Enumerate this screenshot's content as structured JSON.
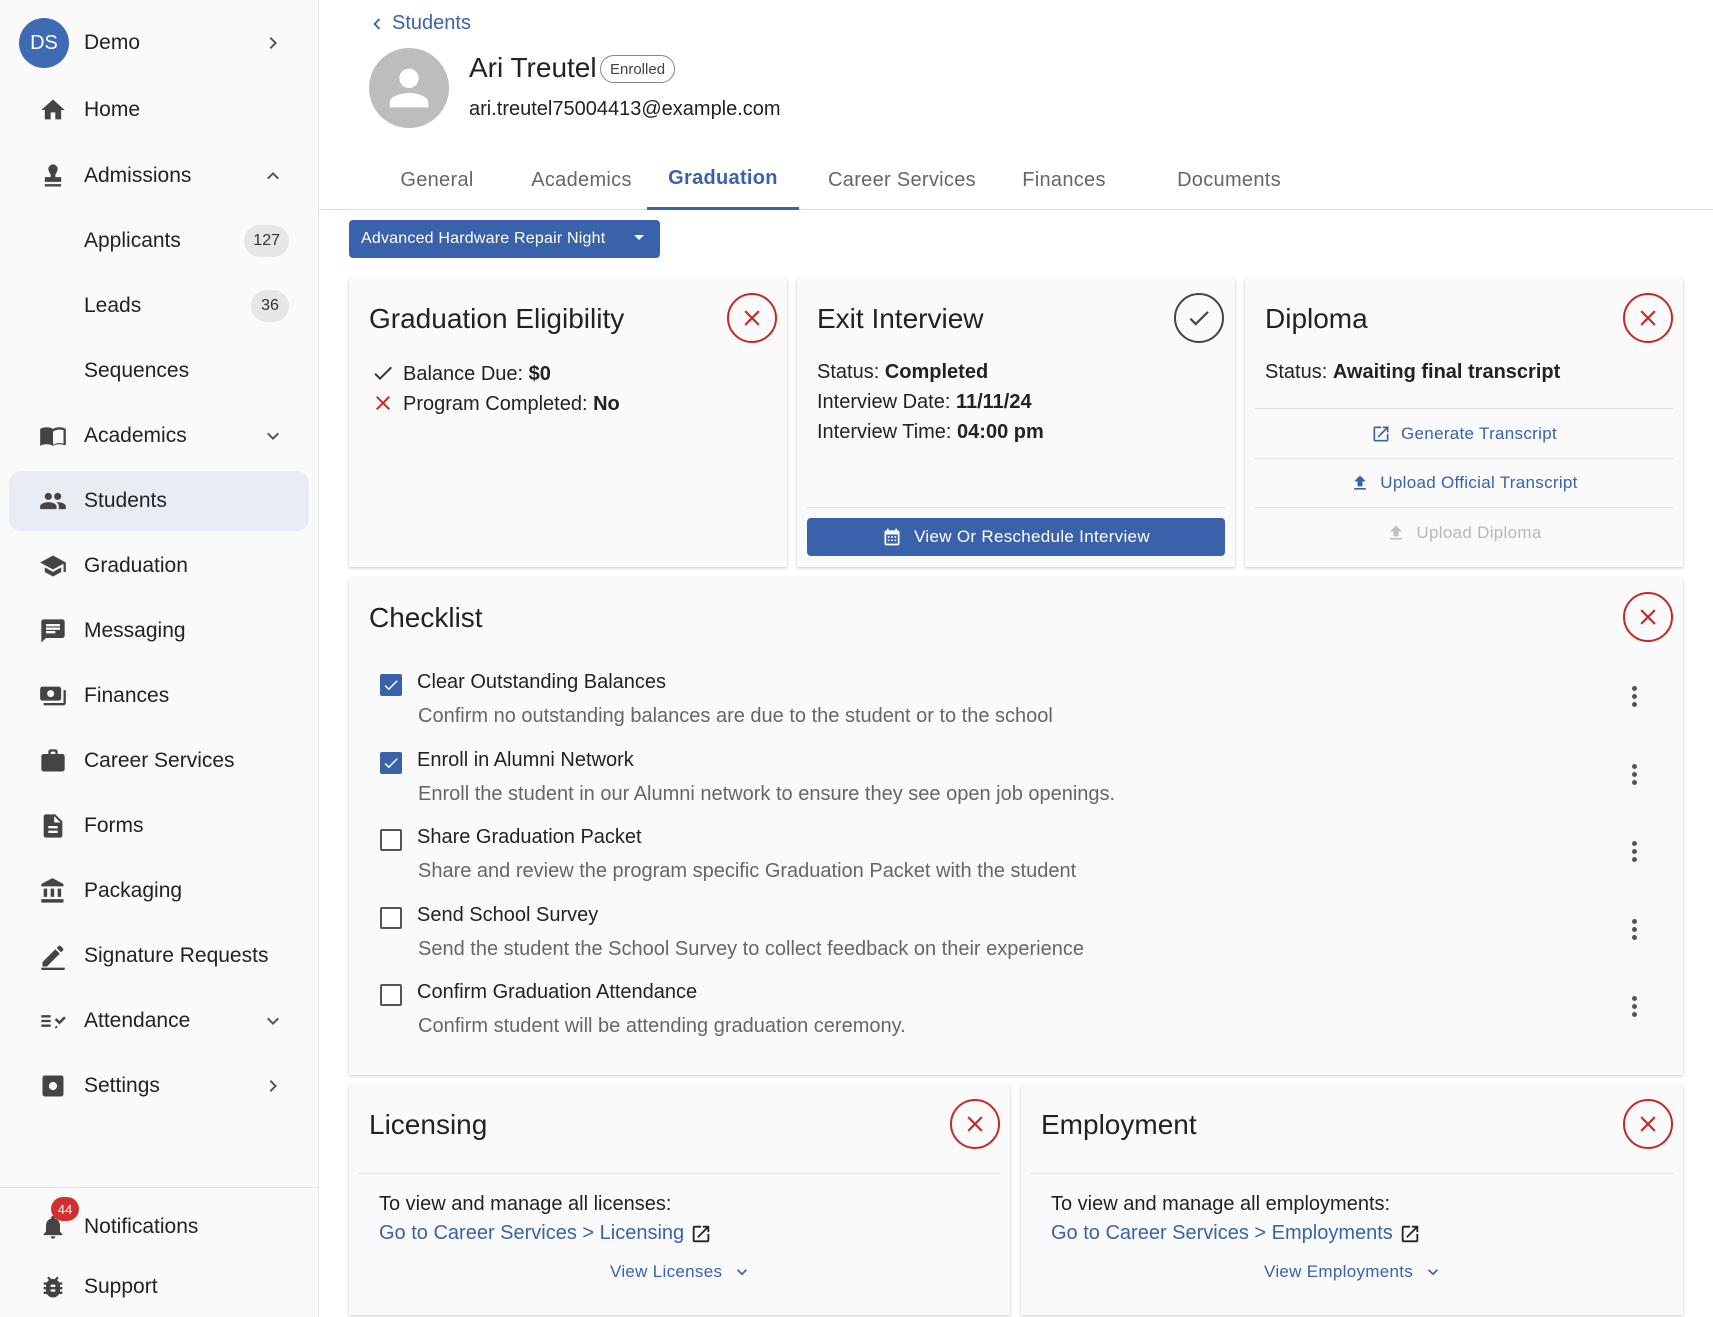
{
  "sidebar": {
    "user": {
      "initials": "DS",
      "name": "Demo"
    },
    "items": [
      {
        "label": "Home"
      },
      {
        "label": "Admissions"
      },
      {
        "label": "Applicants",
        "count": "127"
      },
      {
        "label": "Leads",
        "count": "36"
      },
      {
        "label": "Sequences"
      },
      {
        "label": "Academics"
      },
      {
        "label": "Students"
      },
      {
        "label": "Graduation"
      },
      {
        "label": "Messaging"
      },
      {
        "label": "Finances"
      },
      {
        "label": "Career Services"
      },
      {
        "label": "Forms"
      },
      {
        "label": "Packaging"
      },
      {
        "label": "Signature Requests"
      },
      {
        "label": "Attendance"
      },
      {
        "label": "Settings"
      }
    ],
    "notifications": {
      "label": "Notifications",
      "count": "44"
    },
    "support": {
      "label": "Support"
    },
    "active_item": "Students"
  },
  "header": {
    "back_label": "Students",
    "student_name": "Ari Treutel",
    "status": "Enrolled",
    "email": "ari.treutel75004413@example.com"
  },
  "tabs": [
    {
      "label": "General"
    },
    {
      "label": "Academics"
    },
    {
      "label": "Graduation"
    },
    {
      "label": "Career Services"
    },
    {
      "label": "Finances"
    },
    {
      "label": "Documents"
    }
  ],
  "active_tab": "Graduation",
  "program_select": {
    "value": "Advanced Hardware Repair Night"
  },
  "eligibility": {
    "title": "Graduation Eligibility",
    "rows": [
      {
        "label": "Balance Due:",
        "value": "$0",
        "ok": true
      },
      {
        "label": "Program Completed:",
        "value": "No",
        "ok": false
      }
    ]
  },
  "exit_interview": {
    "title": "Exit Interview",
    "status_label": "Status:",
    "status_value": "Completed",
    "date_label": "Interview Date:",
    "date_value": "11/11/24",
    "time_label": "Interview Time:",
    "time_value": "04:00 pm",
    "button_label": "View Or Reschedule Interview"
  },
  "diploma": {
    "title": "Diploma",
    "status_label": "Status:",
    "status_value": "Awaiting final transcript",
    "actions": [
      {
        "label": "Generate Transcript",
        "enabled": true
      },
      {
        "label": "Upload Official Transcript",
        "enabled": true
      },
      {
        "label": "Upload Diploma",
        "enabled": false
      }
    ]
  },
  "checklist": {
    "title": "Checklist",
    "items": [
      {
        "title": "Clear Outstanding Balances",
        "desc": "Confirm no outstanding balances are due to the student or to the school",
        "checked": true
      },
      {
        "title": "Enroll in Alumni Network",
        "desc": "Enroll the student in our Alumni network to ensure they see open job openings.",
        "checked": true
      },
      {
        "title": "Share Graduation Packet",
        "desc": "Share and review the program specific Graduation Packet with the student",
        "checked": false
      },
      {
        "title": "Send School Survey",
        "desc": "Send the student the School Survey to collect feedback on their experience",
        "checked": false
      },
      {
        "title": "Confirm Graduation Attendance",
        "desc": "Confirm student will be attending graduation ceremony.",
        "checked": false
      }
    ]
  },
  "licensing": {
    "title": "Licensing",
    "intro": "To view and manage all licenses:",
    "link": "Go to Career Services > Licensing",
    "toggle": "View Licenses"
  },
  "employment": {
    "title": "Employment",
    "intro": "To view and manage all employments:",
    "link": "Go to Career Services > Employments",
    "toggle": "View Employments"
  },
  "colors": {
    "accent": "#3a62aa",
    "error": "#c62828",
    "badge": "#d32f2f"
  }
}
